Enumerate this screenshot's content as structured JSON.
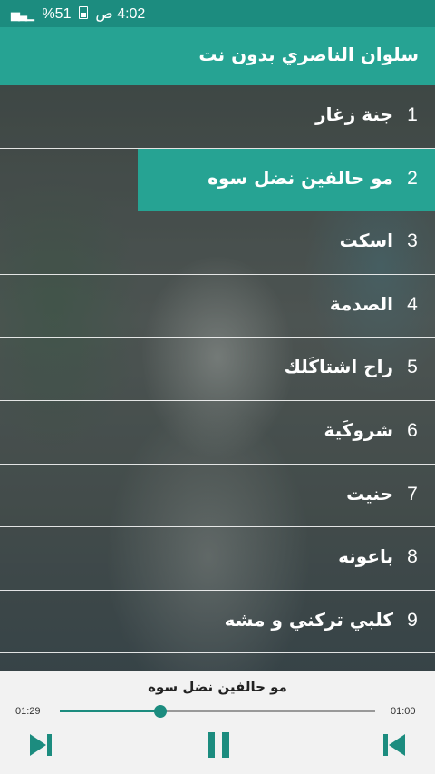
{
  "status_bar": {
    "time": "4:02 ص",
    "battery": "%51"
  },
  "app_bar": {
    "title": "سلوان الناصري بدون نت"
  },
  "playlist": {
    "active_index": 1,
    "items": [
      {
        "number": "1",
        "title": "جنة زغار"
      },
      {
        "number": "2",
        "title": "مو حالفين نضل سوه"
      },
      {
        "number": "3",
        "title": "اسكت"
      },
      {
        "number": "4",
        "title": "الصدمة"
      },
      {
        "number": "5",
        "title": "راح اشتاكَلك"
      },
      {
        "number": "6",
        "title": "شروكَية"
      },
      {
        "number": "7",
        "title": "حنيت"
      },
      {
        "number": "8",
        "title": "باعونه"
      },
      {
        "number": "9",
        "title": "كلبي تركني و مشه"
      }
    ]
  },
  "player": {
    "now_playing": "مو حالفين نضل سوه",
    "elapsed": "01:00",
    "duration": "01:29",
    "progress_fraction": 0.32,
    "accent_color": "#1c8c7f",
    "controls": [
      "next-icon",
      "pause-icon",
      "previous-icon"
    ]
  },
  "colors": {
    "status_bar": "#1c8c7f",
    "app_bar": "#26a393",
    "highlight": "#26a393"
  }
}
